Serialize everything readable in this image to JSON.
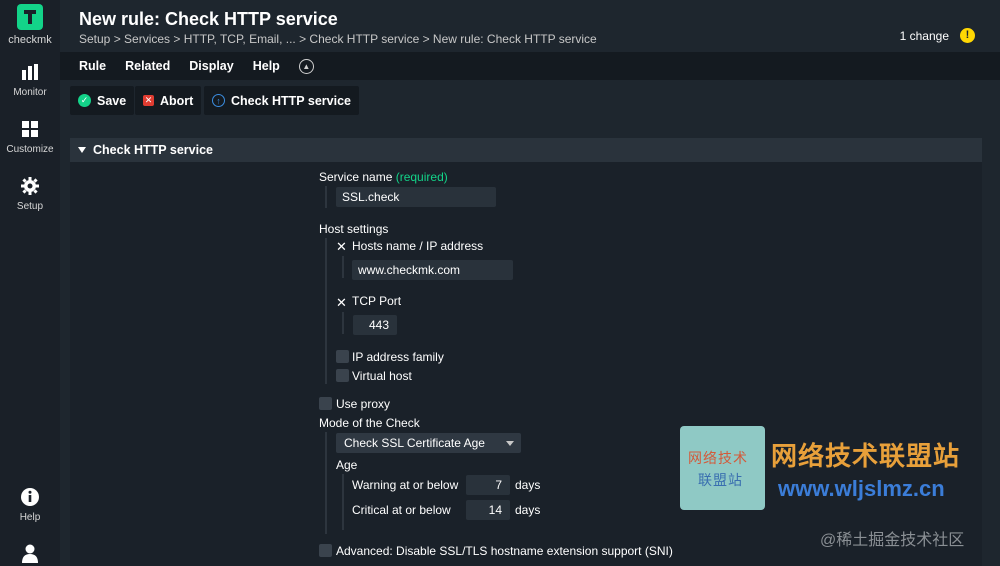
{
  "sidebar": {
    "logo_text": "checkmk",
    "items": [
      {
        "label": "Monitor",
        "icon": "bar-chart-icon"
      },
      {
        "label": "Customize",
        "icon": "grid-icon"
      },
      {
        "label": "Setup",
        "icon": "gear-icon"
      },
      {
        "label": "Help",
        "icon": "info-icon"
      },
      {
        "label": "",
        "icon": "user-icon"
      }
    ]
  },
  "header": {
    "title": "New rule: Check HTTP service",
    "breadcrumb": "Setup > Services > HTTP, TCP, Email, ... > Check HTTP service > New rule: Check HTTP service",
    "changes": "1 change",
    "changes_icon": "warning-icon"
  },
  "menubar": {
    "items": [
      "Rule",
      "Related",
      "Display",
      "Help"
    ]
  },
  "toolbar": {
    "save": "Save",
    "abort": "Abort",
    "check_http": "Check HTTP service"
  },
  "section": {
    "title": "Check HTTP service"
  },
  "form": {
    "service_name_label": "Service name",
    "required_label": "(required)",
    "service_name_value": "SSL.check",
    "host_settings_label": "Host settings",
    "hosts_name_label": "Hosts name / IP address",
    "hosts_name_value": "www.checkmk.com",
    "tcp_port_label": "TCP Port",
    "tcp_port_value": "443",
    "ip_family_label": "IP address family",
    "virtual_host_label": "Virtual host",
    "use_proxy_label": "Use proxy",
    "mode_label": "Mode of the Check",
    "mode_value": "Check SSL Certificate Age",
    "age_label": "Age",
    "warning_label": "Warning at or below",
    "warning_value": "7",
    "critical_label": "Critical at or below",
    "critical_value": "14",
    "days_unit": "days",
    "sni_label": "Advanced: Disable SSL/TLS hostname extension support (SNI)"
  },
  "watermark": {
    "box_line1": "网络技术",
    "box_line2": "联盟站",
    "title": "网络技术联盟站",
    "url": "www.wljslmz.cn",
    "footer": "@稀土掘金技术社区"
  },
  "colors": {
    "accent": "#13d389",
    "warning": "#ffd703",
    "abort": "#e03c31",
    "info": "#3b8de0"
  }
}
